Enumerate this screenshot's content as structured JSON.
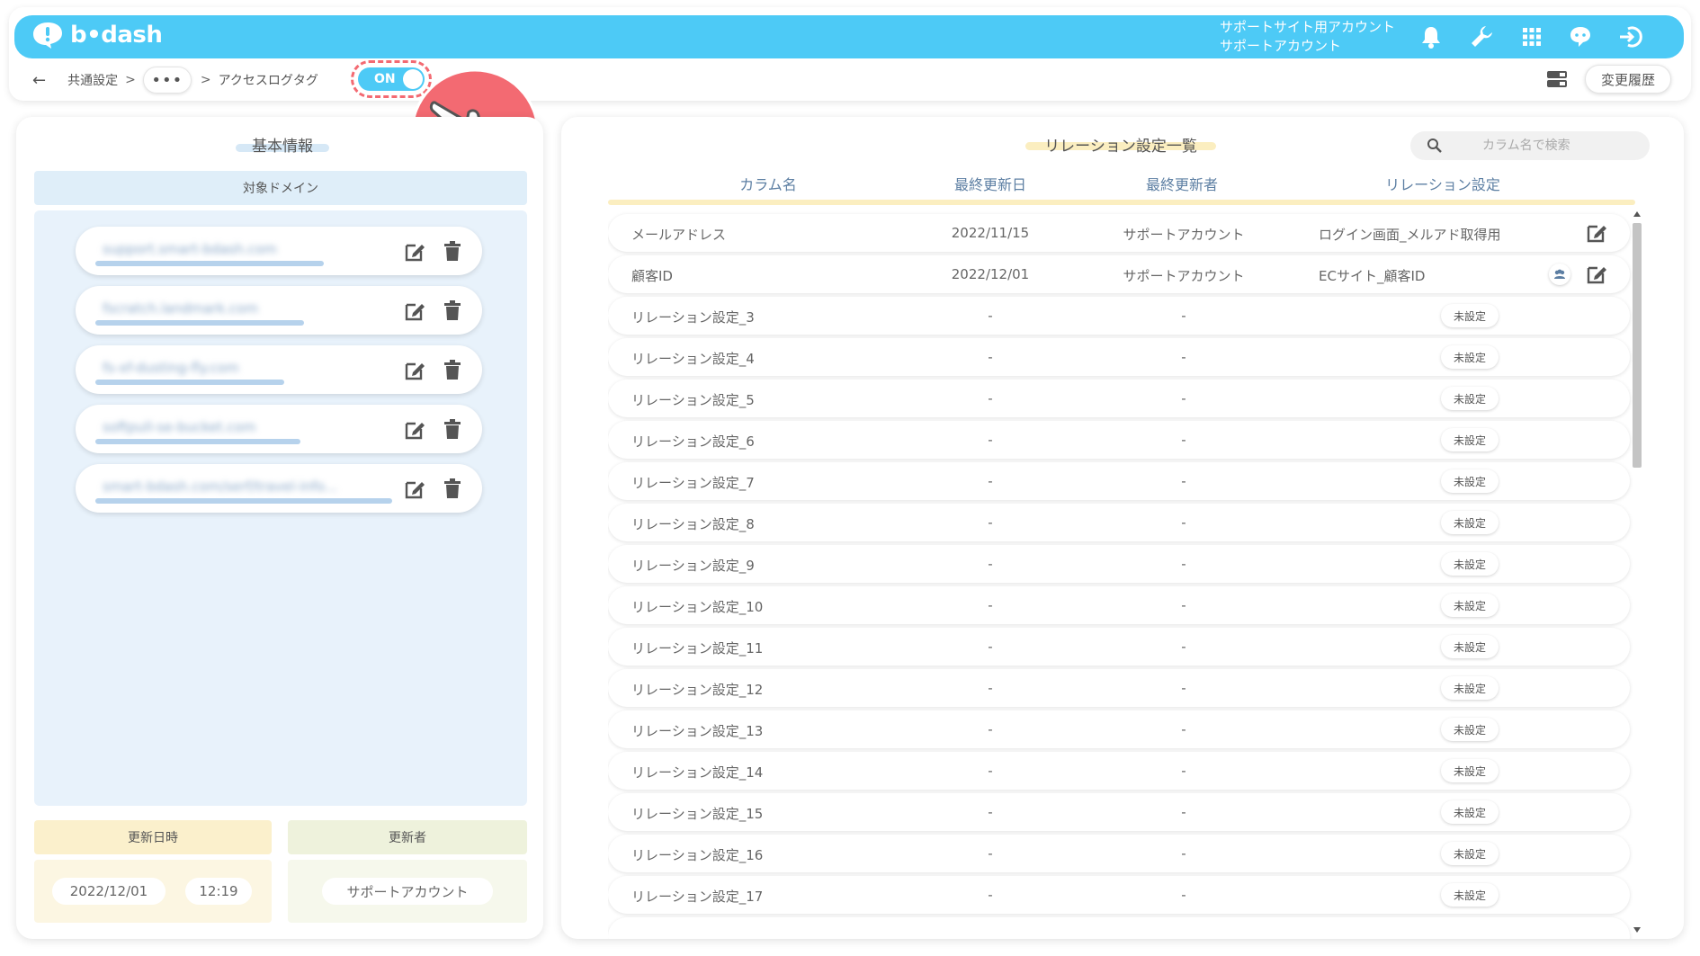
{
  "header": {
    "logo_text": "b•dash",
    "account_line1": "サポートサイト用アカウント",
    "account_line2": "サポートアカウント"
  },
  "breadcrumb": {
    "back": "←",
    "item1": "共通設定",
    "separator": ">",
    "ellipsis": "•••",
    "item2": "アクセスログタグ",
    "toggle_label": "ON"
  },
  "history_button": "変更履歴",
  "left": {
    "title": "基本情報",
    "domain_header": "対象ドメイン",
    "domains": [
      "support.smart-bdash.com",
      "fscratch.landmark.com",
      "fs-xf-dusting-fly.com",
      "softpull-se-bucket.com",
      "smart-bdash.com/serf/travel-info..."
    ],
    "updated_at_label": "更新日時",
    "updated_by_label": "更新者",
    "updated_date": "2022/12/01",
    "updated_time": "12:19",
    "updated_by": "サポートアカウント"
  },
  "right": {
    "title": "リレーション設定一覧",
    "search_placeholder": "カラム名で検索",
    "columns": [
      "カラム名",
      "最終更新日",
      "最終更新者",
      "リレーション設定"
    ],
    "unset_label": "未設定",
    "rows": [
      {
        "name": "メールアドレス",
        "date": "2022/11/15",
        "user": "サポートアカウント",
        "relation": "ログイン画面_メルアド取得用"
      },
      {
        "name": "顧客ID",
        "date": "2022/12/01",
        "user": "サポートアカウント",
        "relation": "ECサイト_顧客ID"
      },
      {
        "name": "リレーション設定_3",
        "date": "-",
        "user": "-"
      },
      {
        "name": "リレーション設定_4",
        "date": "-",
        "user": "-"
      },
      {
        "name": "リレーション設定_5",
        "date": "-",
        "user": "-"
      },
      {
        "name": "リレーション設定_6",
        "date": "-",
        "user": "-"
      },
      {
        "name": "リレーション設定_7",
        "date": "-",
        "user": "-"
      },
      {
        "name": "リレーション設定_8",
        "date": "-",
        "user": "-"
      },
      {
        "name": "リレーション設定_9",
        "date": "-",
        "user": "-"
      },
      {
        "name": "リレーション設定_10",
        "date": "-",
        "user": "-"
      },
      {
        "name": "リレーション設定_11",
        "date": "-",
        "user": "-"
      },
      {
        "name": "リレーション設定_12",
        "date": "-",
        "user": "-"
      },
      {
        "name": "リレーション設定_13",
        "date": "-",
        "user": "-"
      },
      {
        "name": "リレーション設定_14",
        "date": "-",
        "user": "-"
      },
      {
        "name": "リレーション設定_15",
        "date": "-",
        "user": "-"
      },
      {
        "name": "リレーション設定_16",
        "date": "-",
        "user": "-"
      },
      {
        "name": "リレーション設定_17",
        "date": "-",
        "user": "-"
      }
    ]
  },
  "colors": {
    "brand": "#4dcaf6",
    "accent_red": "#f36a72",
    "domain_bg": "#e8f2fb"
  }
}
